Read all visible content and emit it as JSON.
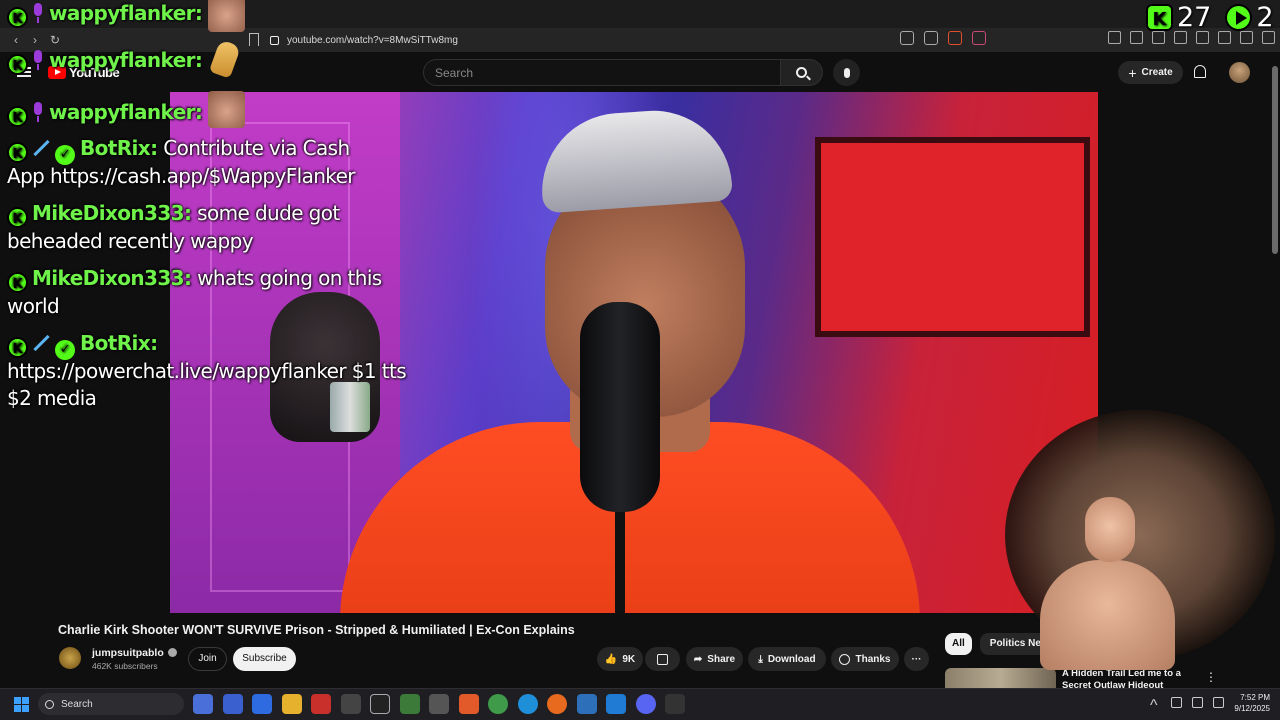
{
  "browser": {
    "url": "youtube.com/watch?v=8MwSiTTw8mg"
  },
  "youtube": {
    "logo_text": "YouTube",
    "search_placeholder": "Search",
    "create_label": "Create"
  },
  "overlay": {
    "counter_left": "27",
    "counter_right": "2",
    "chat": [
      {
        "user": "wappyflanker:",
        "badges": [
          "kick",
          "mic"
        ],
        "emote": "face",
        "text": ""
      },
      {
        "user": "wappyflanker:",
        "badges": [
          "kick",
          "mic"
        ],
        "emote": "burrito",
        "text": ""
      },
      {
        "user": "wappyflanker:",
        "badges": [
          "kick",
          "mic"
        ],
        "emote": "face",
        "text": ""
      },
      {
        "user": "BotRix:",
        "badges": [
          "kick",
          "sword",
          "check"
        ],
        "text": "Contribute via Cash",
        "text2": "App https://cash.app/$WappyFlanker"
      },
      {
        "user": "MikeDixon333:",
        "badges": [
          "kick"
        ],
        "text": "some dude got",
        "text2": "beheaded recently wappy"
      },
      {
        "user": "MikeDixon333:",
        "badges": [
          "kick"
        ],
        "text": "whats going on this",
        "text2": "world"
      },
      {
        "user": "BotRix:",
        "badges": [
          "kick",
          "sword",
          "check"
        ],
        "text": "",
        "text2": "https://powerchat.live/wappyflanker $1 tts",
        "text3": "$2 media"
      }
    ]
  },
  "video": {
    "title": "Charlie Kirk Shooter WON'T SURVIVE Prison - Stripped & Humiliated | Ex-Con Explains",
    "channel": "jumpsuitpablo",
    "subscribers": "462K subscribers",
    "join_label": "Join",
    "subscribe_label": "Subscribe",
    "likes": "9K",
    "share_label": "Share",
    "download_label": "Download",
    "thanks_label": "Thanks",
    "more_label": "···"
  },
  "recommendations": {
    "chips": [
      "All",
      "Politics News"
    ],
    "first_title": "A Hidden Trail Led me to a Secret Outlaw Hideout"
  },
  "taskbar": {
    "search_label": "Search",
    "time": "7:52 PM",
    "date": "9/12/2025"
  },
  "colors": {
    "kick_green": "#53fc18",
    "username_green": "#6ff24a",
    "youtube_red": "#ff0000",
    "background": "#0f0f0f"
  }
}
